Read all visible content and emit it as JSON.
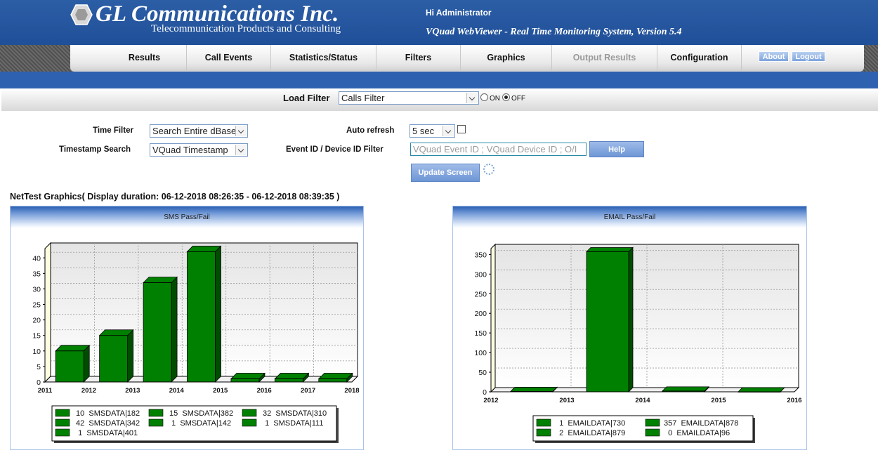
{
  "header": {
    "company": "GL Communications Inc.",
    "tagline": "Telecommunication Products and Consulting",
    "greeting": "Hi Administrator",
    "app_title": "VQuad WebViewer - Real Time Monitoring System, Version 5.4"
  },
  "nav": {
    "items": [
      {
        "label": "Results"
      },
      {
        "label": "Call Events"
      },
      {
        "label": "Statistics/Status"
      },
      {
        "label": "Filters"
      },
      {
        "label": "Graphics"
      },
      {
        "label": "Output Results"
      },
      {
        "label": "Configuration"
      }
    ],
    "about_label": "About",
    "logout_label": "Logout"
  },
  "load_filter": {
    "label": "Load Filter",
    "selected": "Calls Filter",
    "on_label": "ON",
    "off_label": "OFF",
    "state": "OFF"
  },
  "form": {
    "time_filter_label": "Time Filter",
    "time_filter_value": "Search Entire dBase",
    "timestamp_label": "Timestamp Search",
    "timestamp_value": "VQuad Timestamp",
    "auto_refresh_label": "Auto refresh",
    "auto_refresh_value": "5 sec",
    "event_filter_label": "Event ID / Device ID Filter",
    "event_filter_placeholder": "VQuad Event ID ; VQuad Device ID ; O/I",
    "help_label": "Help",
    "update_label": "Update Screen"
  },
  "graphics_title": "NetTest Graphics( Display duration: 06-12-2018 08:26:35 - 06-12-2018 08:39:35 )",
  "colors": {
    "bar": "#008000",
    "bar_dark": "#004d00",
    "header_blue": "#2c5ea6"
  },
  "chart_data": [
    {
      "type": "bar",
      "title": "SMS Pass/Fail",
      "x_ticks": [
        "2011",
        "2012",
        "2013",
        "2014",
        "2015",
        "2016",
        "2017",
        "2018"
      ],
      "categories": [
        "2012",
        "2013",
        "2014",
        "2015",
        "2016",
        "2017",
        "2018"
      ],
      "values": [
        10,
        15,
        32,
        42,
        1,
        1,
        1
      ],
      "y_ticks": [
        0,
        5,
        10,
        15,
        20,
        25,
        30,
        35,
        40
      ],
      "ylim": [
        0,
        43
      ],
      "grid": true,
      "legend_position": "bottom",
      "legend": [
        {
          "count": "10",
          "label": "SMSDATA|182"
        },
        {
          "count": "15",
          "label": "SMSDATA|382"
        },
        {
          "count": "32",
          "label": "SMSDATA|310"
        },
        {
          "count": "42",
          "label": "SMSDATA|342"
        },
        {
          "count": "1",
          "label": "SMSDATA|142"
        },
        {
          "count": "1",
          "label": "SMSDATA|111"
        },
        {
          "count": "1",
          "label": "SMSDATA|401"
        }
      ]
    },
    {
      "type": "bar",
      "title": "EMAIL Pass/Fail",
      "x_ticks": [
        "2012",
        "2013",
        "2014",
        "2015",
        "2016"
      ],
      "categories": [
        "2013",
        "2014",
        "2015",
        "2016"
      ],
      "values": [
        1,
        357,
        2,
        0
      ],
      "y_ticks": [
        0,
        50,
        100,
        150,
        200,
        250,
        300,
        350
      ],
      "ylim": [
        0,
        365
      ],
      "grid": true,
      "legend_position": "bottom",
      "legend": [
        {
          "count": "1",
          "label": "EMAILDATA|730"
        },
        {
          "count": "357",
          "label": "EMAILDATA|878"
        },
        {
          "count": "2",
          "label": "EMAILDATA|879"
        },
        {
          "count": "0",
          "label": "EMAILDATA|96"
        }
      ]
    }
  ]
}
